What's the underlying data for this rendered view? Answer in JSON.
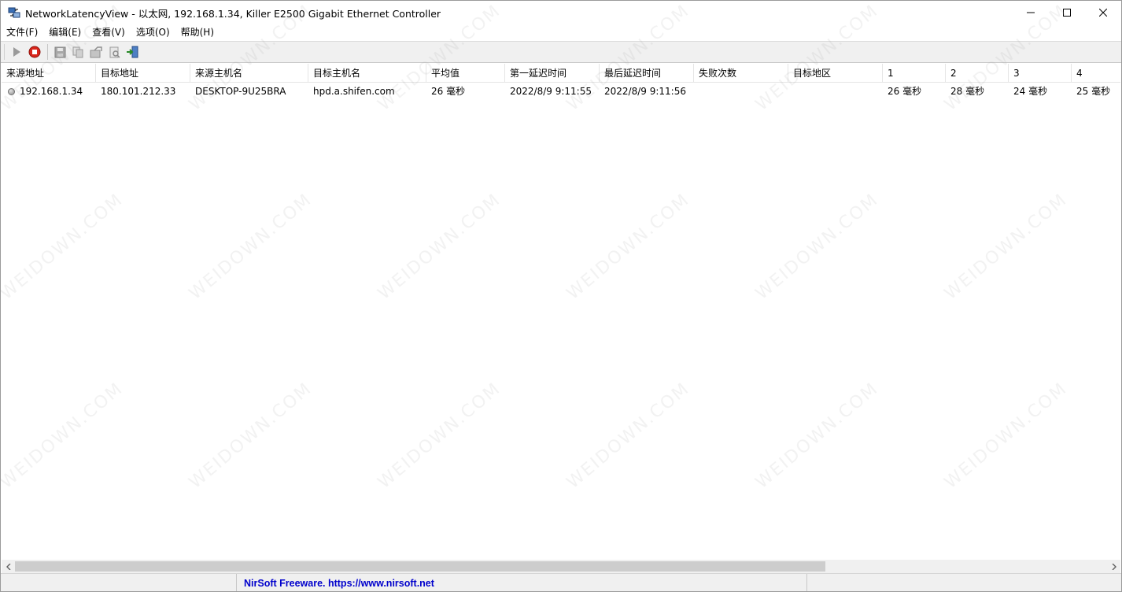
{
  "window": {
    "title": "NetworkLatencyView  -  以太网, 192.168.1.34, Killer E2500 Gigabit Ethernet Controller"
  },
  "menu": [
    {
      "label": "文件(F)"
    },
    {
      "label": "编辑(E)"
    },
    {
      "label": "查看(V)"
    },
    {
      "label": "选项(O)"
    },
    {
      "label": "帮助(H)"
    }
  ],
  "columns": [
    {
      "label": "来源地址"
    },
    {
      "label": "目标地址"
    },
    {
      "label": "来源主机名"
    },
    {
      "label": "目标主机名"
    },
    {
      "label": "平均值"
    },
    {
      "label": "第一延迟时间"
    },
    {
      "label": "最后延迟时间"
    },
    {
      "label": "失败次数"
    },
    {
      "label": "目标地区"
    },
    {
      "label": "1"
    },
    {
      "label": "2"
    },
    {
      "label": "3"
    },
    {
      "label": "4"
    }
  ],
  "rows": [
    {
      "cells": [
        "192.168.1.34",
        "180.101.212.33",
        "DESKTOP-9U25BRA",
        "hpd.a.shifen.com",
        "26 毫秒",
        "2022/8/9 9:11:55",
        "2022/8/9 9:11:56",
        "",
        "",
        "26 毫秒",
        "28 毫秒",
        "24 毫秒",
        "25 毫秒"
      ]
    }
  ],
  "statusbar": {
    "panel1": "",
    "link": "NirSoft Freeware. https://www.nirsoft.net",
    "panel3": ""
  },
  "watermark": "WEIDOWN.COM",
  "colors": {
    "link": "#0000cc",
    "stop_button": "#d9261c",
    "toolbar_bg": "#f0f0f0"
  }
}
